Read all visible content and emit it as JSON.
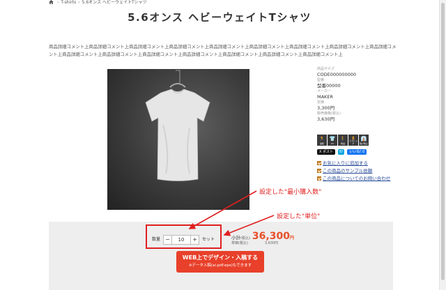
{
  "breadcrumb": {
    "home_glyph": "🏠",
    "sep1": "›",
    "category": "T-shirts",
    "sep2": "›",
    "current": "5.6オンス ヘビーウェイトTシャツ"
  },
  "product": {
    "title": "5.6オンス ヘビーウェイトTシャツ",
    "description": "商品詳細コメント上商品詳細コメント上商品詳細コメント上商品詳細コメント上商品詳細コメント上商品詳細コメント上商品詳細コメント上商品詳細コメント上商品詳細コメント上商品詳細コメント上商品詳細コメント上商品詳細コメント上商品詳細コメント上商品詳細コメント上商品詳細コメント上商品詳細コメント上"
  },
  "specs": {
    "size_label": "商品サイズ",
    "code": "CODE000000000",
    "model_label": "型番",
    "model": "型番00000",
    "maker_label": "メーカー",
    "maker": "MAKER",
    "price_label": "定価",
    "price": "3,300円",
    "sale_label": "販売価格(税込)",
    "sale_price": "3,630円"
  },
  "feature_icons": [
    {
      "icon": "person-icon",
      "glyph": "🏃",
      "label": "速乾"
    },
    {
      "icon": "person-icon",
      "glyph": "👕",
      "label": "UV"
    },
    {
      "icon": "person-icon",
      "glyph": "🚶",
      "label": "防臭"
    },
    {
      "icon": "person-icon",
      "glyph": "🧍",
      "label": "ストレッチ"
    },
    {
      "icon": "person-icon",
      "glyph": "👔",
      "label": "透け防止"
    }
  ],
  "social": {
    "x_post": "X ポスト",
    "hatena": "B!",
    "facebook_like": "いいね! 0"
  },
  "links": {
    "favorite": "お気に入りに追加する",
    "sample": "この商品のサンプル依頼",
    "inquiry": "この商品についてのお問い合わせ"
  },
  "cart": {
    "qty_label": "数量",
    "minus": "−",
    "qty_value": "10",
    "plus": "+",
    "unit": "セット",
    "subtotal_label": "小計",
    "tax_incl": "(税込)",
    "subtotal_value": "36,300",
    "yen": "円",
    "unit_price_label": "単価",
    "unit_price_tax": "(税込)",
    "unit_price_value": "3,630円",
    "cta_line1": "WEB上でデザイン・入稿する",
    "cta_line2": "※データ入稿(ai.pdf.eps)もできます"
  },
  "annotations": {
    "min_qty": "設定した\"最小購入数\"",
    "unit": "設定した\"単位\""
  },
  "colors": {
    "accent": "#e8402a",
    "annotation": "#e02020",
    "link": "#2a4d9a"
  }
}
